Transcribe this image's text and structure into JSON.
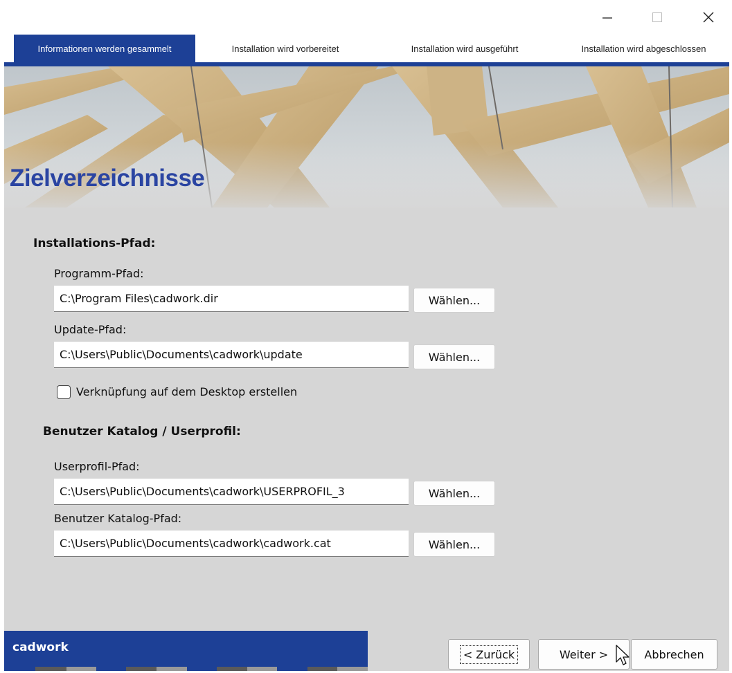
{
  "window": {
    "controls": {
      "minimize": "minimize-icon",
      "maximize": "maximize-icon",
      "close": "close-icon"
    }
  },
  "steps": [
    {
      "label": "Informationen werden gesammelt",
      "active": true
    },
    {
      "label": "Installation wird vorbereitet",
      "active": false
    },
    {
      "label": "Installation wird ausgeführt",
      "active": false
    },
    {
      "label": "Installation wird abgeschlossen",
      "active": false
    }
  ],
  "page_title": "Zielverzeichnisse",
  "install_section": {
    "heading": "Installations-Pfad:",
    "program_label": "Programm-Pfad:",
    "program_value": "C:\\Program Files\\cadwork.dir",
    "update_label": "Update-Pfad:",
    "update_value": "C:\\Users\\Public\\Documents\\cadwork\\update",
    "shortcut_label": "Verknüpfung auf dem Desktop erstellen",
    "shortcut_checked": false
  },
  "user_section": {
    "heading": "Benutzer Katalog / Userprofil:",
    "userprofile_label": "Userprofil-Pfad:",
    "userprofile_value": "C:\\Users\\Public\\Documents\\cadwork\\USERPROFIL_3",
    "catalog_label": "Benutzer Katalog-Pfad:",
    "catalog_value": "C:\\Users\\Public\\Documents\\cadwork\\cadwork.cat"
  },
  "choose_label": "Wählen...",
  "brand": "cadwork",
  "buttons": {
    "back": "< Zurück",
    "next": "Weiter >",
    "cancel": "Abbrechen"
  },
  "colors": {
    "accent": "#1d4096",
    "title": "#2a44a2",
    "panel": "#d6d6d6"
  }
}
